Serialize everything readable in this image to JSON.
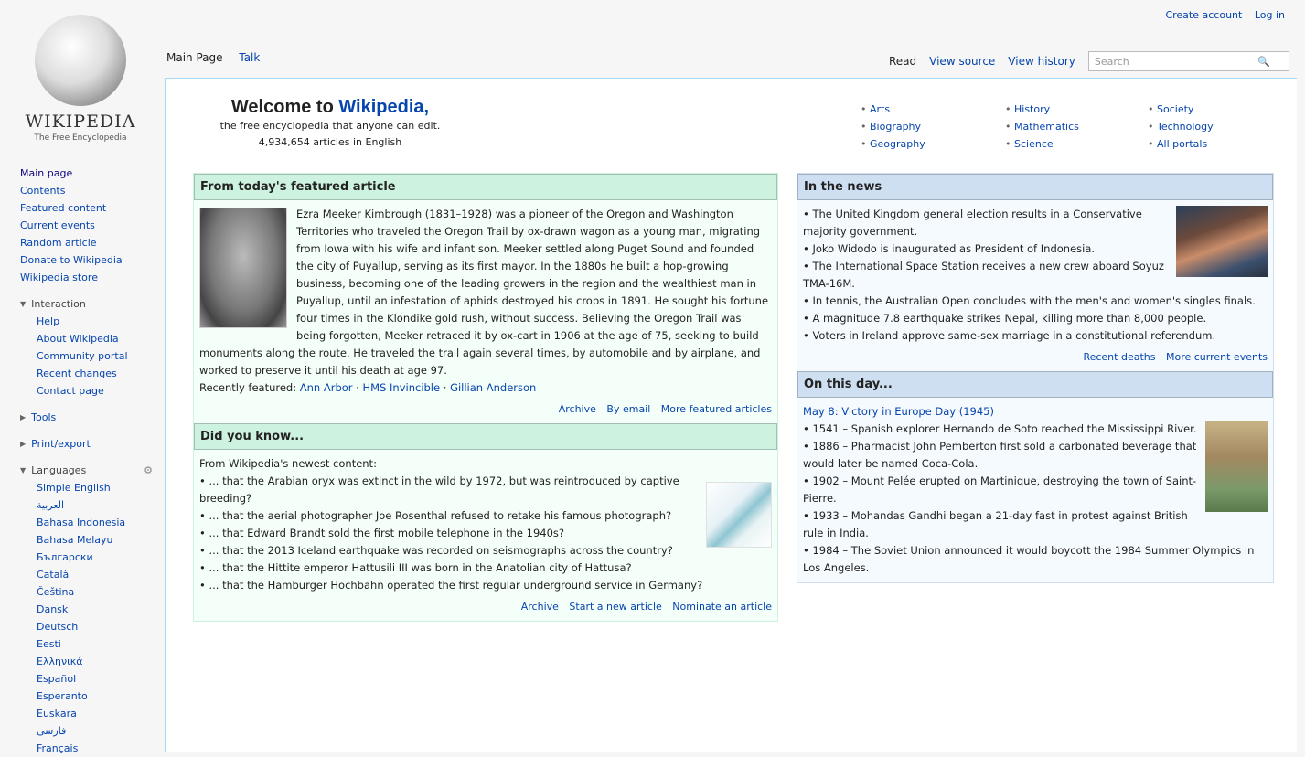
{
  "personal": {
    "create_account": "Create account",
    "login": "Log in"
  },
  "logo": {
    "wordmark": "WIKIPEDIA",
    "tagline": "The Free Encyclopedia"
  },
  "sidebar": {
    "nav": [
      "Main page",
      "Contents",
      "Featured content",
      "Current events",
      "Random article",
      "Donate to Wikipedia",
      "Wikipedia store"
    ],
    "interaction_head": "Interaction",
    "interaction": [
      "Help",
      "About Wikipedia",
      "Community portal",
      "Recent changes",
      "Contact page"
    ],
    "tools_head": "Tools",
    "print_head": "Print/export",
    "languages_head": "Languages",
    "languages": [
      "Simple English",
      "العربية",
      "Bahasa Indonesia",
      "Bahasa Melayu",
      "Български",
      "Català",
      "Čeština",
      "Dansk",
      "Deutsch",
      "Eesti",
      "Ελληνικά",
      "Español",
      "Esperanto",
      "Euskara",
      "فارسی",
      "Français"
    ]
  },
  "tabs": {
    "main_page": "Main Page",
    "talk": "Talk",
    "read": "Read",
    "view_source": "View source",
    "view_history": "View history",
    "search_placeholder": "Search"
  },
  "welcome": {
    "line1": "Welcome to",
    "brand": "Wikipedia,",
    "line2": "the free encyclopedia that anyone can edit.",
    "line3": "4,934,654 articles in English"
  },
  "portals": [
    [
      "Arts",
      "Biography",
      "Geography"
    ],
    [
      "History",
      "Mathematics",
      "Science"
    ],
    [
      "Society",
      "Technology",
      "All portals"
    ]
  ],
  "featured": {
    "heading": "From today's featured article",
    "text": "Ezra Meeker Kimbrough (1831–1928) was a pioneer of the Oregon and Washington Territories who traveled the Oregon Trail by ox-drawn wagon as a young man, migrating from Iowa with his wife and infant son. Meeker settled along Puget Sound and founded the city of Puyallup, serving as its first mayor. In the 1880s he built a hop-growing business, becoming one of the leading growers in the region and the wealthiest man in Puyallup, until an infestation of aphids destroyed his crops in 1891. He sought his fortune four times in the Klondike gold rush, without success. Believing the Oregon Trail was being forgotten, Meeker retraced it by ox-cart in 1906 at the age of 75, seeking to build monuments along the route. He traveled the trail again several times, by automobile and by airplane, and worked to preserve it until his death at age 97.",
    "recent_label": "Recently featured:",
    "recent": [
      "Ann Arbor",
      "HMS Invincible",
      "Gillian Anderson"
    ],
    "footer": [
      "Archive",
      "By email",
      "More featured articles"
    ]
  },
  "dyk": {
    "heading": "Did you know...",
    "intro": "From Wikipedia's newest content:",
    "items": [
      "... that the Arabian oryx was extinct in the wild by 1972, but was reintroduced by captive breeding?",
      "... that the aerial photographer Joe Rosenthal refused to retake his famous photograph?",
      "... that Edward Brandt sold the first mobile telephone in the 1940s?",
      "... that the 2013 Iceland earthquake was recorded on seismographs across the country?",
      "... that the Hittite emperor Hattusili III was born in the Anatolian city of Hattusa?",
      "... that the Hamburger Hochbahn operated the first regular underground service in Germany?"
    ],
    "footer": [
      "Archive",
      "Start a new article",
      "Nominate an article"
    ]
  },
  "news": {
    "heading": "In the news",
    "items": [
      "The United Kingdom general election results in a Conservative majority government.",
      "Joko Widodo is inaugurated as President of Indonesia.",
      "The International Space Station receives a new crew aboard Soyuz TMA-16M.",
      "In tennis, the Australian Open concludes with the men's and women's singles finals.",
      "A magnitude 7.8 earthquake strikes Nepal, killing more than 8,000 people.",
      "Voters in Ireland approve same-sex marriage in a constitutional referendum."
    ],
    "footer": [
      "Recent deaths",
      "More current events"
    ]
  },
  "otd": {
    "heading": "On this day...",
    "date": "May 8: Victory in Europe Day (1945)",
    "items": [
      "1541 – Spanish explorer Hernando de Soto reached the Mississippi River.",
      "1886 – Pharmacist John Pemberton first sold a carbonated beverage that would later be named Coca-Cola.",
      "1902 – Mount Pelée erupted on Martinique, destroying the town of Saint-Pierre.",
      "1933 – Mohandas Gandhi began a 21-day fast in protest against British rule in India.",
      "1984 – The Soviet Union announced it would boycott the 1984 Summer Olympics in Los Angeles."
    ]
  }
}
